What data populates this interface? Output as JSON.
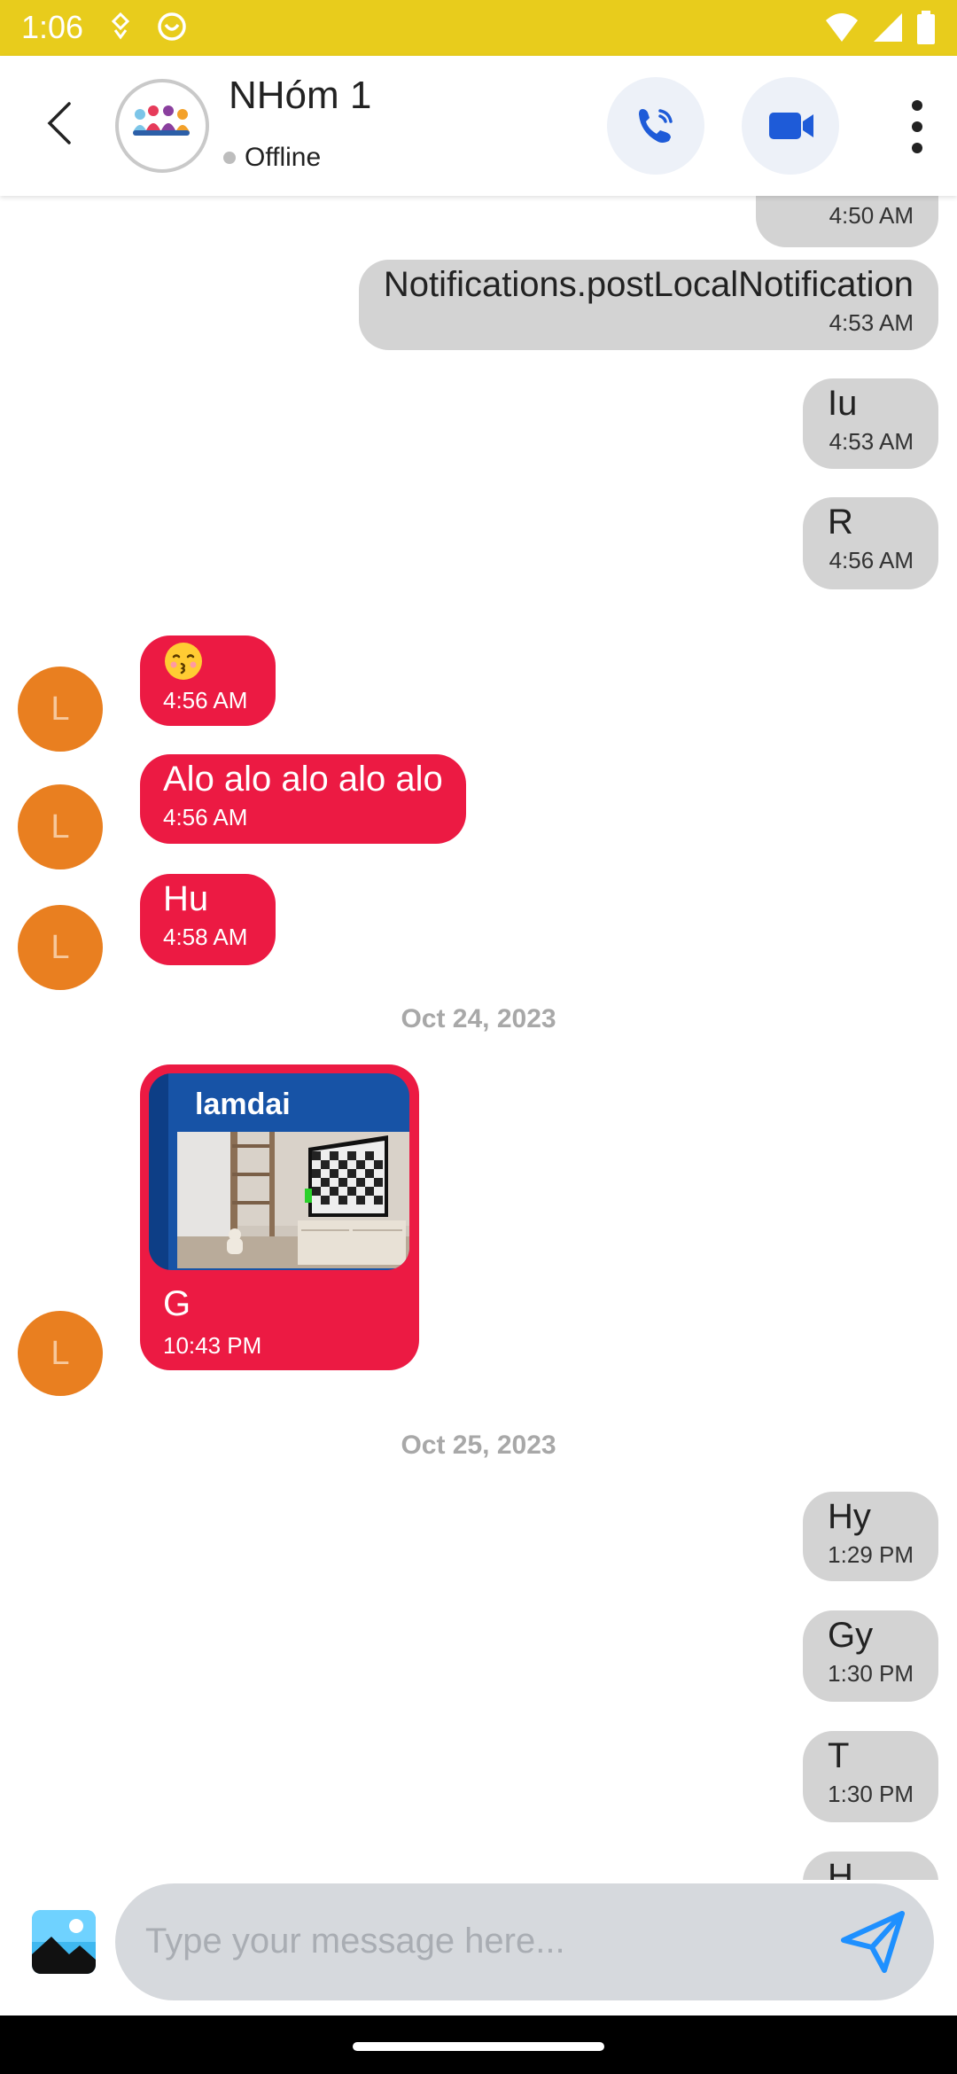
{
  "status_bar": {
    "time": "1:06"
  },
  "header": {
    "title": "NHóm 1",
    "presence": "Offline",
    "colors": {
      "accent": "#1e5bd8",
      "button_bg": "#edf1f8"
    }
  },
  "messages": [
    {
      "side": "out",
      "text": "",
      "time": "4:50 AM"
    },
    {
      "side": "out",
      "text": "Notifications.postLocalNotification",
      "time": "4:53 AM"
    },
    {
      "side": "out",
      "text": "Iu",
      "time": "4:53 AM"
    },
    {
      "side": "out",
      "text": "R",
      "time": "4:56 AM"
    },
    {
      "side": "in",
      "avatar": "L",
      "text": "😙",
      "time": "4:56 AM"
    },
    {
      "side": "in",
      "avatar": "L",
      "text": "Alo alo alo alo alo",
      "time": "4:56 AM"
    },
    {
      "side": "in",
      "avatar": "L",
      "text": "Hu",
      "time": "4:58 AM"
    },
    {
      "side": "divider",
      "text": "Oct 24, 2023"
    },
    {
      "side": "in",
      "avatar": "L",
      "reply_to": "lamdai",
      "text": "G",
      "time": "10:43 PM"
    },
    {
      "side": "divider",
      "text": "Oct 25, 2023"
    },
    {
      "side": "out",
      "text": "Hy",
      "time": "1:29 PM"
    },
    {
      "side": "out",
      "text": "Gy",
      "time": "1:30 PM"
    },
    {
      "side": "out",
      "text": "T",
      "time": "1:30 PM"
    },
    {
      "side": "out",
      "text": "H",
      "time": ""
    }
  ],
  "composer": {
    "placeholder": "Type your message here..."
  },
  "colors": {
    "incoming": "#ec1a43",
    "outgoing": "#d3d3d3",
    "status_bar": "#e8cc1c",
    "sender_avatar": "#e97f20"
  },
  "icons": [
    "back-icon",
    "phone-icon",
    "video-icon",
    "more-vert-icon",
    "gallery-icon",
    "send-icon"
  ]
}
